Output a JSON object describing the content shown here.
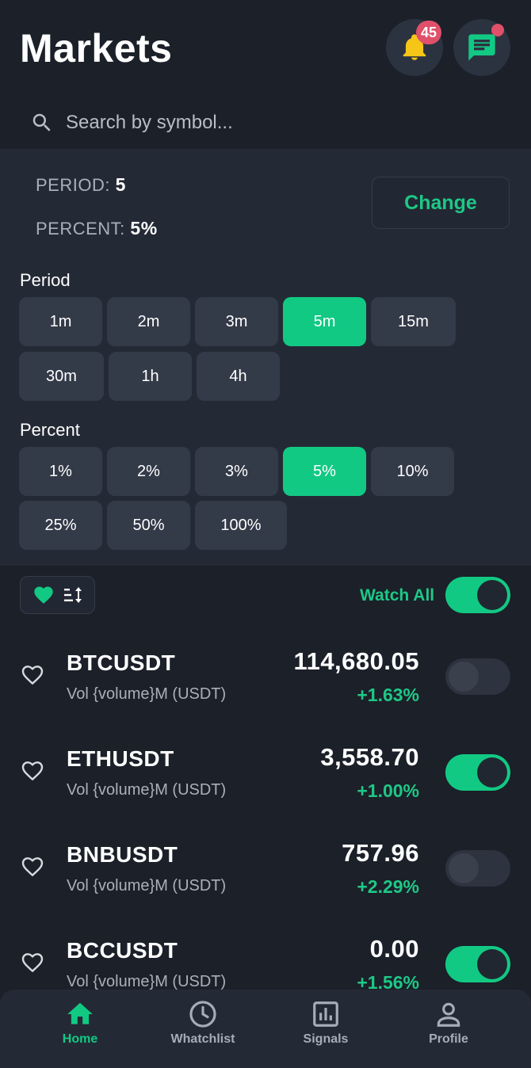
{
  "header": {
    "title": "Markets",
    "notification_count": "45"
  },
  "search": {
    "placeholder": "Search by symbol..."
  },
  "settings": {
    "period_label": "PERIOD:",
    "period_value": "5",
    "percent_label": "PERCENT:",
    "percent_value": "5%",
    "change_label": "Change"
  },
  "filters": {
    "period_title": "Period",
    "period_options": [
      "1m",
      "2m",
      "3m",
      "5m",
      "15m",
      "30m",
      "1h",
      "4h"
    ],
    "period_selected": "5m",
    "percent_title": "Percent",
    "percent_options": [
      "1%",
      "2%",
      "3%",
      "5%",
      "10%",
      "25%",
      "50%",
      "100%"
    ],
    "percent_selected": "5%"
  },
  "list_controls": {
    "watch_all_label": "Watch All",
    "watch_all_on": true
  },
  "markets": [
    {
      "symbol": "BTCUSDT",
      "volume": "Vol {volume}M (USDT)",
      "price": "114,680.05",
      "change": "+1.63%",
      "watched": false
    },
    {
      "symbol": "ETHUSDT",
      "volume": "Vol {volume}M (USDT)",
      "price": "3,558.70",
      "change": "+1.00%",
      "watched": true
    },
    {
      "symbol": "BNBUSDT",
      "volume": "Vol {volume}M (USDT)",
      "price": "757.96",
      "change": "+2.29%",
      "watched": false
    },
    {
      "symbol": "BCCUSDT",
      "volume": "Vol {volume}M (USDT)",
      "price": "0.00",
      "change": "+1.56%",
      "watched": true
    }
  ],
  "nav": {
    "home": "Home",
    "watchlist": "Whatchlist",
    "signals": "Signals",
    "profile": "Profile"
  },
  "colors": {
    "background": "#1b2029",
    "panel": "#242a35",
    "accent": "#12c984",
    "badge": "#e0506a",
    "bell": "#f5c518"
  }
}
